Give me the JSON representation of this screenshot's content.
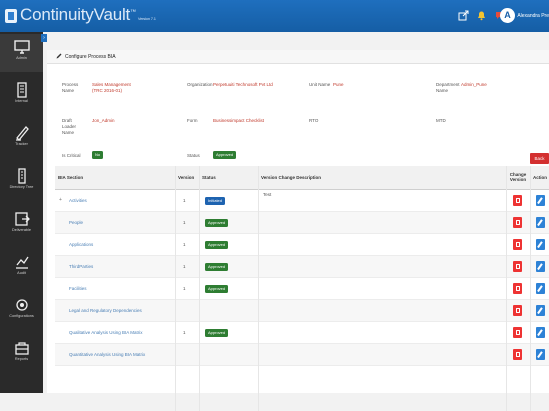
{
  "app": {
    "name": "ContinuityVault",
    "trademark": "™",
    "version": "Version 7.1",
    "user_initial": "A",
    "user_name": "Alexandra Pre"
  },
  "sidebar": {
    "items": [
      {
        "label": "Admin",
        "icon": "monitor-icon"
      },
      {
        "label": "Internal",
        "icon": "building-icon"
      },
      {
        "label": "Tracker",
        "icon": "tracker-icon"
      },
      {
        "label": "Directory Tree",
        "icon": "directory-icon"
      },
      {
        "label": "Deliverable",
        "icon": "deliverable-icon"
      },
      {
        "label": "Audit",
        "icon": "audit-icon"
      },
      {
        "label": "Configurations",
        "icon": "configurations-icon"
      },
      {
        "label": "Reports",
        "icon": "reports-icon"
      }
    ]
  },
  "panel": {
    "title": "Configure Process BIA"
  },
  "form": {
    "process_name_label": "Process Name",
    "process_name_value": "Sales Management (TRC 2016-01)",
    "organization_label": "Organization",
    "organization_value": "Perpetuuiti Technosoft Pvt Ltd",
    "unit_name_label": "Unit Name",
    "unit_name_value": "Pune",
    "department_label": "Department Name",
    "department_value": "Admin_Pune",
    "owner_label": "Draft Loader Name",
    "owner_value": "Jon_Admin",
    "form_label": "Form",
    "form_value": "Businessimpact Checklist",
    "rto_label": "RTO",
    "mtd_label": "MTD",
    "is_critical_label": "Is Critical",
    "is_critical_value": "No",
    "status_label": "Status",
    "status_value": "Approved",
    "back_label": "Back"
  },
  "table": {
    "headers": {
      "bia_section": "BIA Section",
      "version": "Version",
      "status": "Status",
      "change_description": "Version Change Description",
      "change_version": "Change Version",
      "action": "Action"
    },
    "rows": [
      {
        "name": "Activities",
        "version": "1",
        "status": "Initiated",
        "status_type": "blue",
        "desc": "Test"
      },
      {
        "name": "People",
        "version": "1",
        "status": "Approved",
        "status_type": "green",
        "desc": ""
      },
      {
        "name": "Applications",
        "version": "1",
        "status": "Approved",
        "status_type": "green",
        "desc": ""
      },
      {
        "name": "ThirdParties",
        "version": "1",
        "status": "Approved",
        "status_type": "green",
        "desc": ""
      },
      {
        "name": "Facilities",
        "version": "1",
        "status": "Approved",
        "status_type": "green",
        "desc": ""
      },
      {
        "name": "Legal and Regulatory Dependencies",
        "version": "",
        "status": "",
        "status_type": "",
        "desc": ""
      },
      {
        "name": "Qualitative Analysis Using BIA Matrix",
        "version": "1",
        "status": "Approved",
        "status_type": "green",
        "desc": ""
      },
      {
        "name": "Quantitative Analysis Using BIA Matrix",
        "version": "",
        "status": "",
        "status_type": "",
        "desc": ""
      }
    ]
  },
  "colors": {
    "topbar": "#1a64b1",
    "sidebar": "#2a2a2a",
    "approved": "#2e7d32",
    "initiated": "#1e63b0",
    "danger": "#d32f2f",
    "edit": "#2d82d6"
  }
}
